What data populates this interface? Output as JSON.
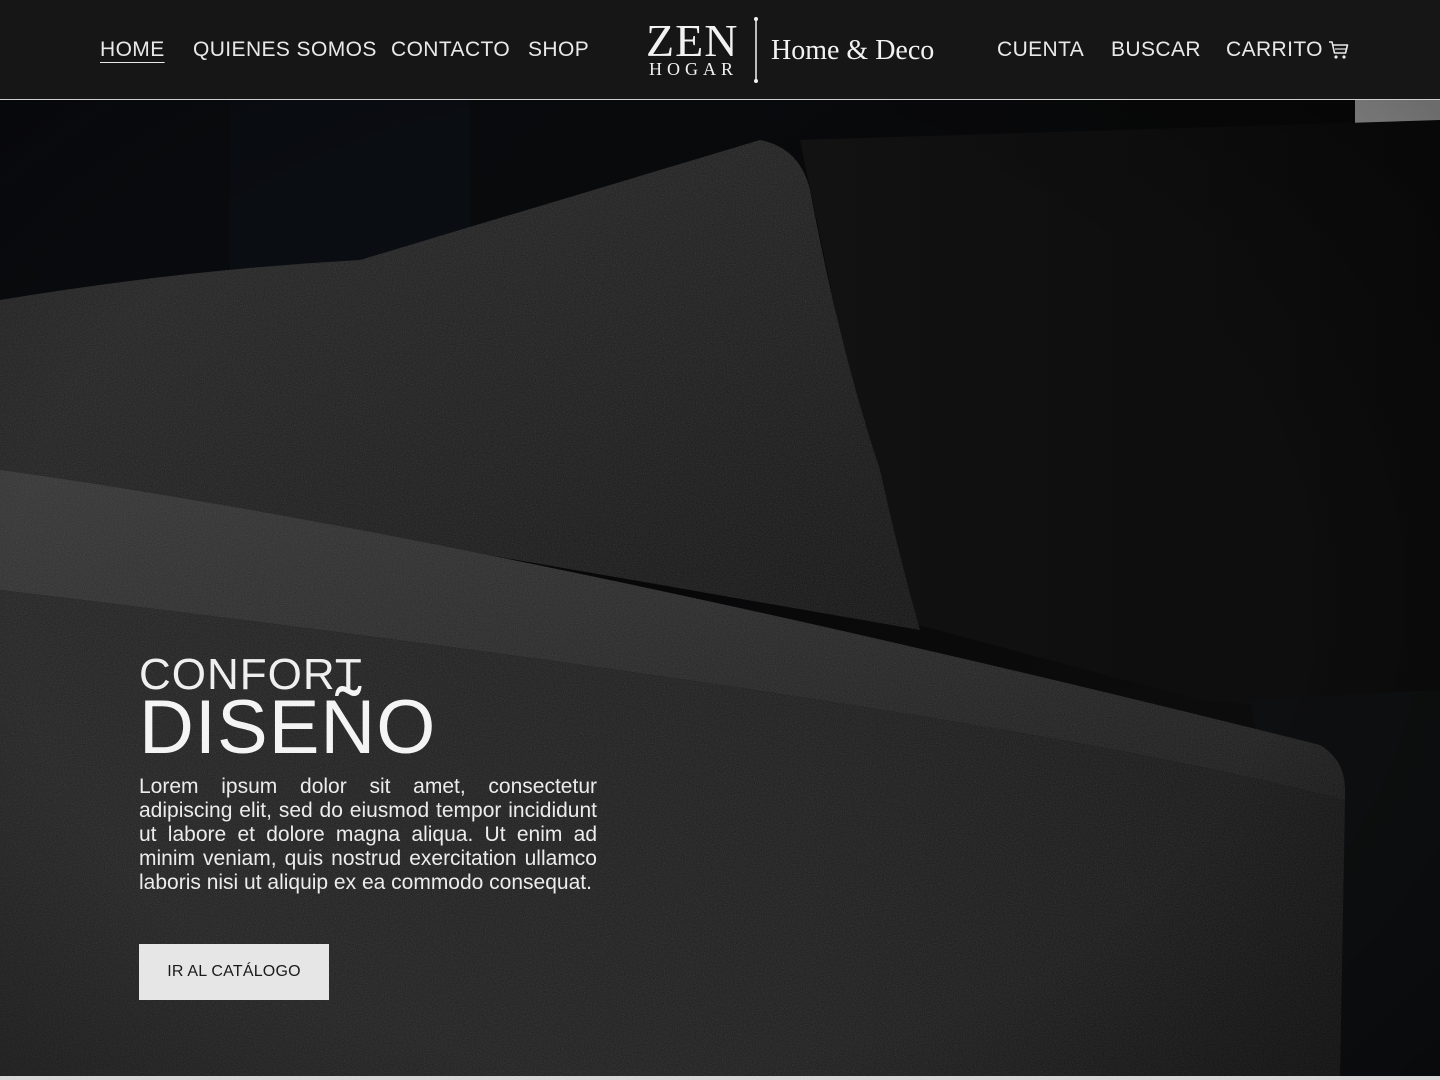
{
  "brand": {
    "name_top": "ZEN",
    "name_bottom": "HOGAR",
    "tagline": "Home & Deco"
  },
  "nav": {
    "left": [
      {
        "label": "HOME",
        "active": true
      },
      {
        "label": "QUIENES SOMOS",
        "active": false
      },
      {
        "label": "CONTACTO",
        "active": false
      },
      {
        "label": "SHOP",
        "active": false
      }
    ],
    "right": [
      {
        "label": "CUENTA"
      },
      {
        "label": "BUSCAR"
      },
      {
        "label": "CARRITO",
        "icon": "cart-icon"
      }
    ]
  },
  "hero": {
    "line1": "CONFORT",
    "line2": "DISEÑO",
    "body": "Lorem ipsum dolor sit amet, consectetur adipiscing elit, sed do eiusmod tempor incididunt ut labore et dolore magna aliqua. Ut enim ad minim veniam, quis nostrud exercitation ullamco laboris nisi ut aliquip ex ea commodo consequat.",
    "cta_label": "IR AL CATÁLOGO"
  },
  "colors": {
    "header_bg": "#181818",
    "text": "#e9e9e9",
    "cta_bg": "#e6e6e6",
    "cta_text": "#1a1a1a"
  }
}
